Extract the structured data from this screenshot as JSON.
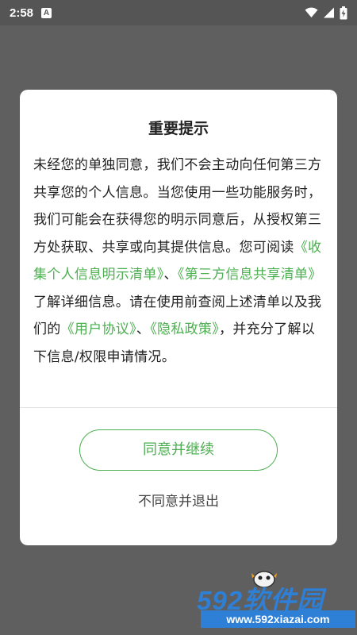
{
  "status_bar": {
    "time": "2:58",
    "icons": [
      "a-notification-icon",
      "wifi-icon",
      "signal-icon",
      "battery-icon"
    ]
  },
  "dialog": {
    "title": "重要提示",
    "body": {
      "p1": "未经您的单独同意，我们不会主动向任何第三方共享您的个人信息。当您使用一些功能服务时，我们可能会在获得您的明示同意后，从授权第三方处获取、共享或向其提供信息。您可阅读",
      "link_collect": "《收集个人信息明示清单》",
      "sep1": "、",
      "link_third_party": "《第三方信息共享清单》",
      "p2": "了解详细信息。请在使用前查阅上述清单以及我们的",
      "link_user_agreement": "《用户协议》",
      "sep2": "、",
      "link_privacy": "《隐私政策》",
      "p3": "，并充分了解以下信息/权限申请情况。"
    },
    "agree_label": "同意并继续",
    "disagree_label": "不同意并退出"
  },
  "watermark": {
    "logo_text": "592软件园",
    "url": "www.592xiazai.com"
  },
  "colors": {
    "accent": "#4caf50",
    "overlay": "#5f5f5f",
    "watermark_blue": "#2e7fd6"
  }
}
